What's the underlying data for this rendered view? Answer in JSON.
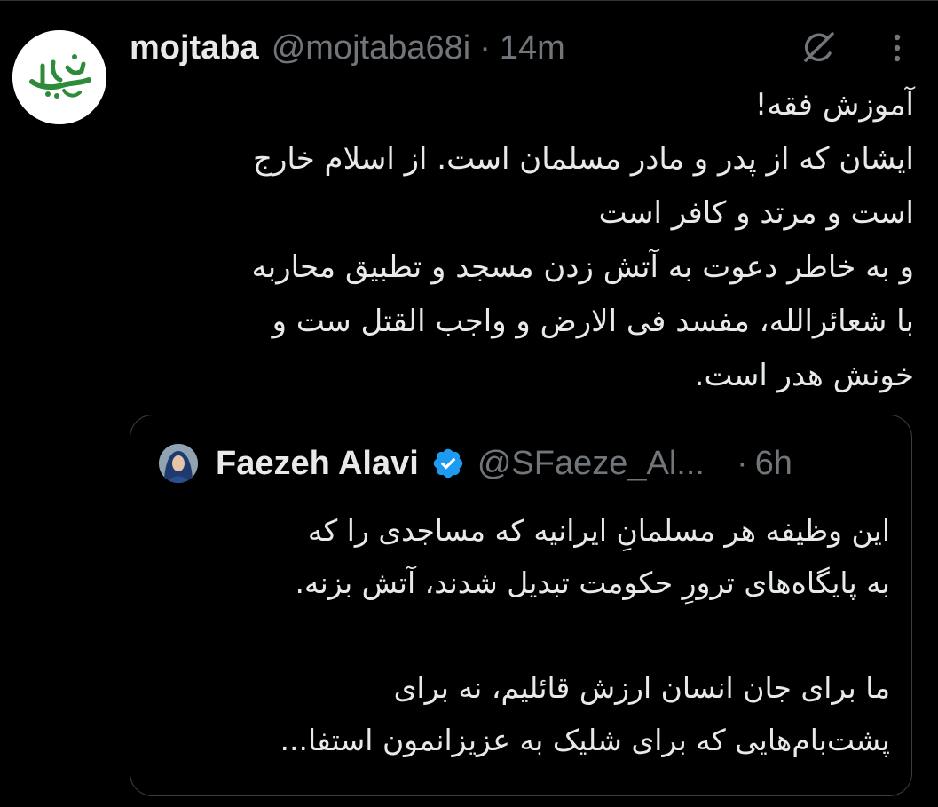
{
  "tweet": {
    "author": {
      "display_name": "mojtaba",
      "handle": "@mojtaba68i",
      "avatar_icon": "calligraphy-logo-avatar"
    },
    "separator": "·",
    "time": "14m",
    "grok_icon": "grok-icon",
    "more_icon": "more-icon",
    "text_lines": [
      "آموزش فقه!",
      "ایشان که از پدر و مادر مسلمان است. از اسلام خارج",
      "است و مرتد و کافر است",
      "و به خاطر دعوت به آتش زدن مسجد و تطبیق محاربه",
      "با شعائرالله، مفسد فی الارض و واجب القتل ست و",
      "خونش هدر است."
    ]
  },
  "quoted_tweet": {
    "author": {
      "display_name": "Faezeh Alavi",
      "handle": "@SFaeze_Al...",
      "verified_icon": "verified-badge-icon",
      "verified_color": "#1d9bf0"
    },
    "separator": "·",
    "time": "6h",
    "text_lines": [
      "این وظیفه هر مسلمانِ ایرانیه که مساجدی را که",
      "به پایگاه‌های ترورِ حکومت تبدیل شدند، آتش بزنه.",
      "",
      "ما برای جان انسان ارزش قائلیم، نه برای",
      "پشت‌بام‌هایی که برای شلیک به عزیزانمون استفا..."
    ]
  },
  "colors": {
    "background": "#000000",
    "primary_text": "#e7e9ea",
    "secondary_text": "#71767b",
    "border": "#3b3f42",
    "avatar_calligraphy": "#2e8b3a"
  }
}
